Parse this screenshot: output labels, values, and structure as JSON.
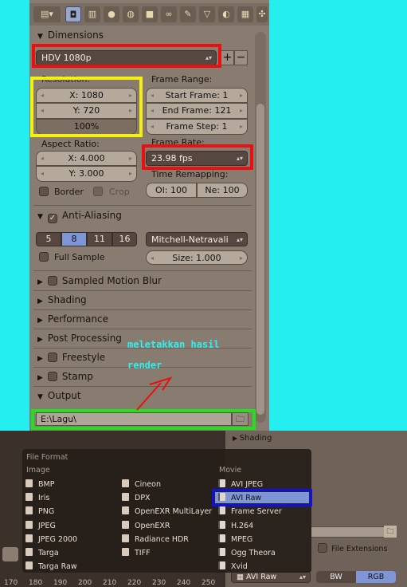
{
  "colors": {
    "background": "#24eef0",
    "annotation_red": "#e81010",
    "annotation_yellow": "#f4f010",
    "annotation_green": "#22e020",
    "annotation_blue": "#1010e0",
    "selection": "#7f96d6"
  },
  "tabs": [
    "render-layers-icon",
    "camera-icon",
    "render-layers-icon",
    "scene-icon",
    "world-icon",
    "object-icon",
    "constraints-icon",
    "modifier-icon",
    "mesh-data-icon",
    "material-icon",
    "texture-icon",
    "particles-icon"
  ],
  "dimensions": {
    "header": "Dimensions",
    "preset": "HDV 1080p",
    "resolution_label": "Resolution:",
    "res_x": "X: 1080",
    "res_y": "Y: 720",
    "res_pct": "100%",
    "frame_range_label": "Frame Range:",
    "start_frame": "Start Frame: 1",
    "end_frame": "End Frame: 121",
    "frame_step": "Frame Step: 1",
    "aspect_label": "Aspect Ratio:",
    "aspect_x": "X: 4.000",
    "aspect_y": "Y: 3.000",
    "frame_rate_label": "Frame Rate:",
    "frame_rate": "23.98 fps",
    "time_remap_label": "Time Remapping:",
    "old": "Ol: 100",
    "new": "Ne: 100",
    "border": "Border",
    "crop": "Crop"
  },
  "antialiasing": {
    "header": "Anti-Aliasing",
    "samples": [
      "5",
      "8",
      "11",
      "16"
    ],
    "selected": "8",
    "filter": "Mitchell-Netravali",
    "full_sample": "Full Sample",
    "size": "Size: 1.000"
  },
  "sections": [
    "Sampled Motion Blur",
    "Shading",
    "Performance",
    "Post Processing",
    "Freestyle",
    "Stamp",
    "Output"
  ],
  "output": {
    "path": "E:\\Lagu\\"
  },
  "annotation": {
    "line1": "meletakkan hasil",
    "line2": "render"
  },
  "lower": {
    "shading": "Shading",
    "file_extensions": "File Extensions",
    "file_format": "AVI Raw",
    "bw": "BW",
    "rgb": "RGB",
    "ruler": [
      "170",
      "180",
      "190",
      "200",
      "210",
      "220",
      "230",
      "240",
      "250"
    ]
  },
  "menu": {
    "title": "File Format",
    "image_header": "Image",
    "movie_header": "Movie",
    "image_col1": [
      "BMP",
      "Iris",
      "PNG",
      "JPEG",
      "JPEG 2000",
      "Targa",
      "Targa Raw"
    ],
    "image_col2": [
      "Cineon",
      "DPX",
      "OpenEXR MultiLayer",
      "OpenEXR",
      "Radiance HDR",
      "TIFF"
    ],
    "movie": [
      "AVI JPEG",
      "AVI Raw",
      "Frame Server",
      "H.264",
      "MPEG",
      "Ogg Theora",
      "Xvid"
    ],
    "selected": "AVI Raw"
  }
}
